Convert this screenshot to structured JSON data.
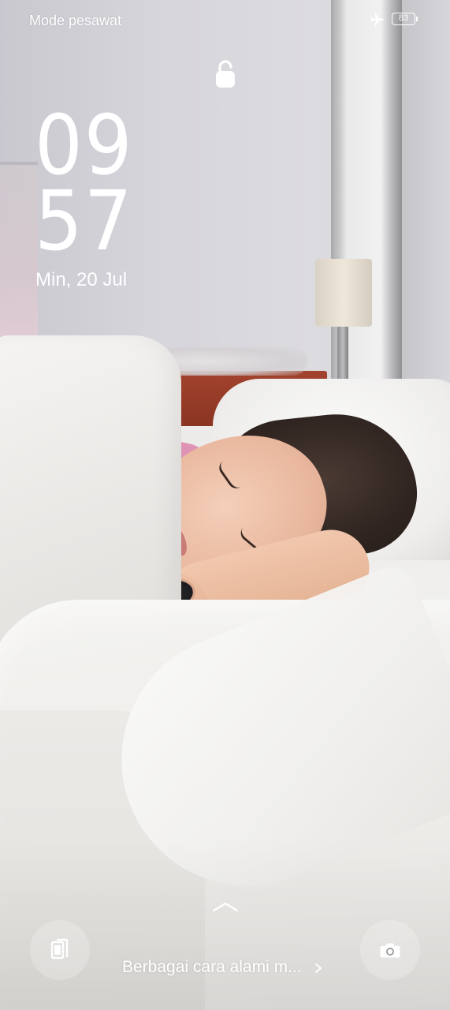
{
  "status_bar": {
    "carrier": "Mode pesawat",
    "airplane_icon": "airplane-icon",
    "battery_level": "83"
  },
  "lock": {
    "icon": "lock-icon"
  },
  "clock": {
    "hour": "09",
    "minute": "57",
    "date": "Min, 20 Jul"
  },
  "bottom": {
    "swipe_icon": "chevron-up-icon",
    "left_button_icon": "magazine-icon",
    "right_button_icon": "camera-icon",
    "caption": "Berbagai cara alami m...",
    "caption_icon": "chevron-right-icon"
  },
  "colors": {
    "text": "#ffffff",
    "button_bg": "rgba(255,255,255,0.22)"
  }
}
